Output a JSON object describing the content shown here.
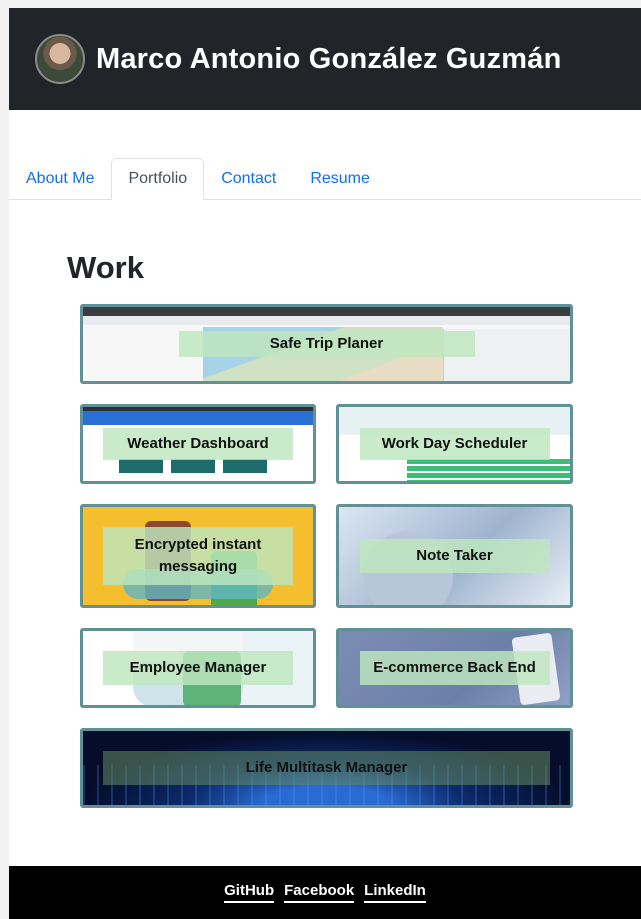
{
  "header": {
    "name": "Marco Antonio González Guzmán",
    "avatar": "profile-photo"
  },
  "tabs": [
    {
      "label": "About Me",
      "active": false
    },
    {
      "label": "Portfolio",
      "active": true
    },
    {
      "label": "Contact",
      "active": false
    },
    {
      "label": "Resume",
      "active": false
    }
  ],
  "section": {
    "title": "Work"
  },
  "projects": [
    {
      "title": "Safe Trip Planer"
    },
    {
      "title": "Weather Dashboard"
    },
    {
      "title": "Work Day Scheduler"
    },
    {
      "title": "Encrypted instant messaging"
    },
    {
      "title": "Note Taker"
    },
    {
      "title": "Employee Manager"
    },
    {
      "title": "E-commerce Back End"
    },
    {
      "title": "Life Multitask Manager"
    }
  ],
  "footer": {
    "links": [
      "GitHub",
      "Facebook",
      "LinkedIn"
    ]
  },
  "colors": {
    "header_bg": "#212529",
    "card_border": "#5f9196",
    "tab_link": "#0d6efd",
    "footer_bg": "#000000"
  }
}
